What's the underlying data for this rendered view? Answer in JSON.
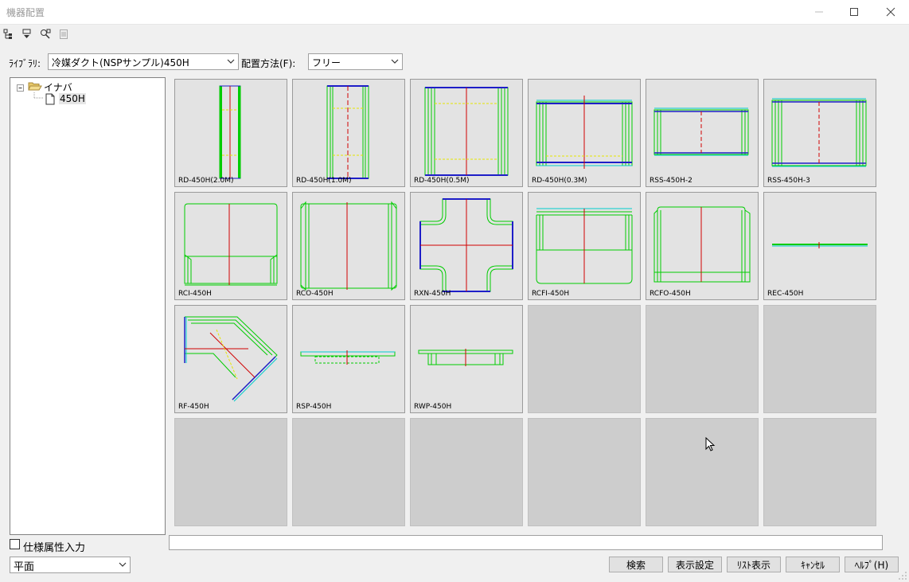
{
  "window": {
    "title": "機器配置"
  },
  "toolbar": {
    "icons": [
      "tree-expand-icon",
      "tree-collapse-icon",
      "search-link-icon",
      "document-icon"
    ]
  },
  "library": {
    "label": "ﾗｲﾌﾞﾗﾘ:",
    "value": "冷媒ダクト(NSPサンプル)450H"
  },
  "placement": {
    "label": "配置方法(F):",
    "value": "フリー"
  },
  "tree": {
    "root": "イナバ",
    "child": "450H"
  },
  "items": [
    {
      "name": "RD-450H(2.0M)"
    },
    {
      "name": "RD-450H(1.0M)"
    },
    {
      "name": "RD-450H(0.5M)"
    },
    {
      "name": "RD-450H(0.3M)"
    },
    {
      "name": "RSS-450H-2"
    },
    {
      "name": "RSS-450H-3"
    },
    {
      "name": "RCI-450H"
    },
    {
      "name": "RCO-450H"
    },
    {
      "name": "RXN-450H"
    },
    {
      "name": "RCFI-450H"
    },
    {
      "name": "RCFO-450H"
    },
    {
      "name": "REC-450H"
    },
    {
      "name": "RF-450H"
    },
    {
      "name": "RSP-450H"
    },
    {
      "name": "RWP-450H"
    }
  ],
  "spec_checkbox": {
    "label": "仕様属性入力"
  },
  "view_select": {
    "value": "平面"
  },
  "buttons": {
    "search": "検索",
    "display_settings": "表示設定",
    "list_view": "ﾘｽﾄ表示",
    "cancel": "ｷｬﾝｾﾙ",
    "help": "ﾍﾙﾌﾟ(H)"
  }
}
